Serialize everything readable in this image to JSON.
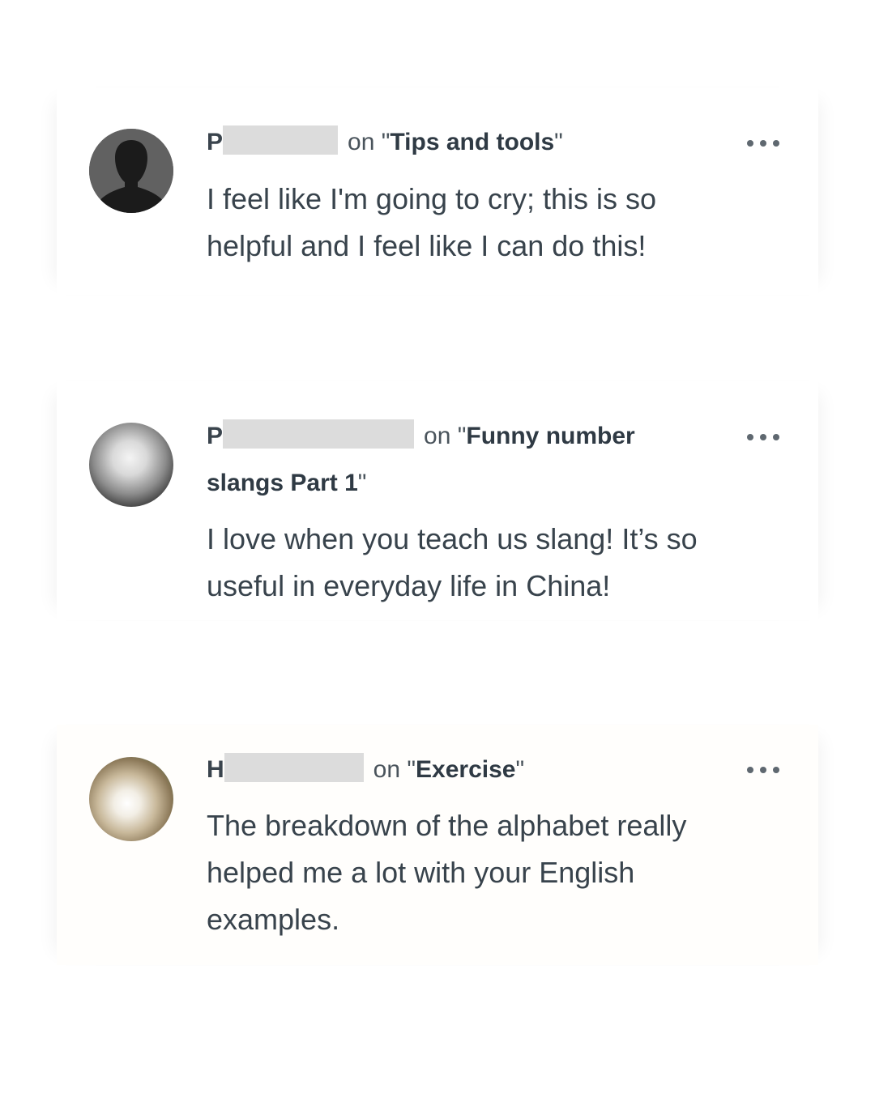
{
  "comments": [
    {
      "initial": "P",
      "on_prefix": "on \"",
      "topic": "Tips and tools",
      "on_suffix": "\"",
      "text": "I feel like I'm going to cry; this is so helpful and I feel like I can do this!",
      "avatar_icon": "silhouette-avatar-icon"
    },
    {
      "initial": "P",
      "on_prefix": "on \"",
      "topic": "Funny number slangs Part 1",
      "on_suffix": "\"",
      "text": "I love when you teach us slang! It’s so useful in everyday life in China!",
      "avatar_icon": "blurred-photo-avatar"
    },
    {
      "initial": "H",
      "on_prefix": "on \"",
      "topic": "Exercise",
      "on_suffix": "\"",
      "text": "The breakdown of the alphabet really helped me a lot with your English examples.",
      "avatar_icon": "blurred-photo-avatar"
    }
  ],
  "menu_icon": "more-options-icon",
  "colors": {
    "redaction": "#dcdcdc",
    "text": "#38434c",
    "muted": "#4a545c"
  }
}
